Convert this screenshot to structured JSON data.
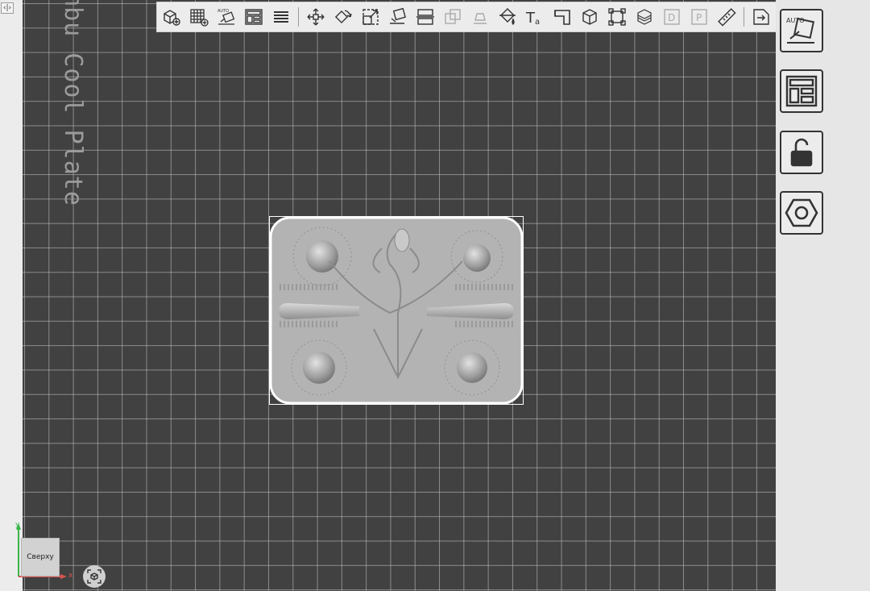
{
  "app": {
    "collapse_toggle_label": "‹|›"
  },
  "plate": {
    "name": "ambu Cool Plate"
  },
  "toolbar": {
    "tools": [
      {
        "name": "add-object",
        "icon": "cube-plus-icon"
      },
      {
        "name": "add-plate",
        "icon": "grid-plus-icon"
      },
      {
        "name": "auto-orient",
        "icon": "auto-orient-icon"
      },
      {
        "name": "arrange",
        "icon": "arrange-icon"
      },
      {
        "name": "split-layers",
        "icon": "layers-icon"
      },
      {
        "name": "move",
        "icon": "move-icon"
      },
      {
        "name": "rotate",
        "icon": "rotate-icon"
      },
      {
        "name": "scale",
        "icon": "scale-icon"
      },
      {
        "name": "lay-on-face",
        "icon": "lay-on-face-icon"
      },
      {
        "name": "cut",
        "icon": "cut-icon"
      },
      {
        "name": "boolean",
        "icon": "boolean-icon"
      },
      {
        "name": "support-paint",
        "icon": "support-paint-icon"
      },
      {
        "name": "color-paint",
        "icon": "color-paint-icon"
      },
      {
        "name": "text",
        "icon": "text-icon"
      },
      {
        "name": "seam",
        "icon": "seam-icon"
      },
      {
        "name": "measure-box",
        "icon": "box-icon"
      },
      {
        "name": "fit",
        "icon": "fit-icon"
      },
      {
        "name": "variable-layer",
        "icon": "variable-layer-icon"
      },
      {
        "name": "assembly-d",
        "icon": "assembly-icon"
      },
      {
        "name": "assembly-p",
        "icon": "assembly-p-icon"
      },
      {
        "name": "measure",
        "icon": "ruler-icon"
      },
      {
        "name": "view-switch",
        "icon": "view-switch-icon"
      }
    ],
    "auto_label": "AUTO"
  },
  "right_panel": {
    "auto_label": "AUTO"
  },
  "view": {
    "cube_label": "Сверху",
    "axis_x": "x",
    "axis_y": "y"
  }
}
